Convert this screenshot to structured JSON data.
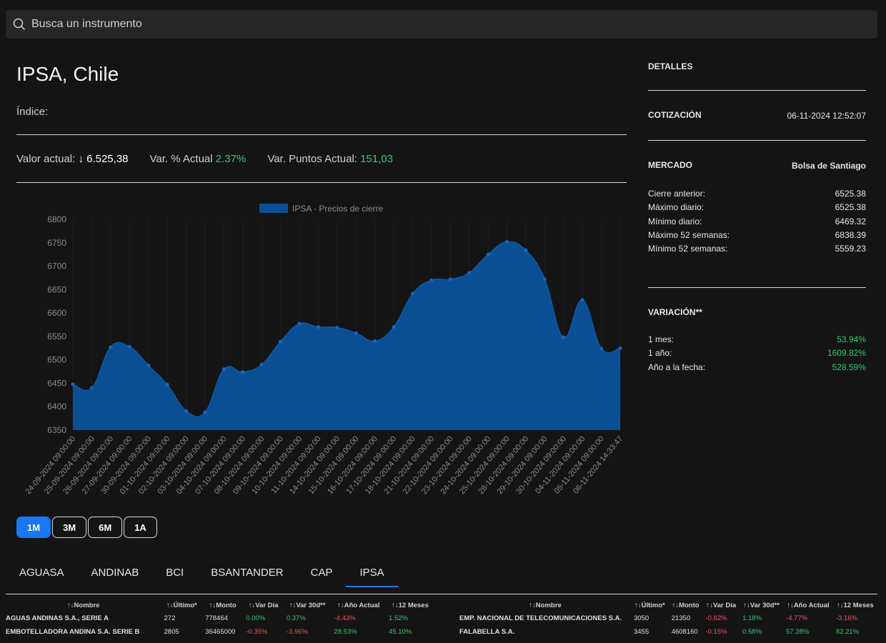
{
  "search": {
    "placeholder": "Busca un instrumento"
  },
  "instrument": {
    "title": "IPSA, Chile",
    "subtitle": "Índice:",
    "valor_label": "Valor actual:",
    "valor_arrow": "↓",
    "valor": "6.525,38",
    "var_pct_label": "Var. % Actual",
    "var_pct": "2.37%",
    "var_pts_label": "Var. Puntos Actual:",
    "var_pts": "151,03"
  },
  "chart_data": {
    "type": "area",
    "legend": "IPSA - Precios de cierre",
    "color": "#0a4f94",
    "ylim": [
      6350,
      6800
    ],
    "yticks": [
      6350,
      6400,
      6450,
      6500,
      6550,
      6600,
      6650,
      6700,
      6750,
      6800
    ],
    "x": [
      "24-09-2024 09:00:00",
      "25-09-2024 09:00:00",
      "26-09-2024 09:00:00",
      "27-09-2024 09:00:00",
      "30-09-2024 09:00:00",
      "01-10-2024 09:00:00",
      "02-10-2024 09:00:00",
      "03-10-2024 09:00:00",
      "04-10-2024 09:00:00",
      "07-10-2024 09:00:00",
      "08-10-2024 09:00:00",
      "09-10-2024 09:00:00",
      "10-10-2024 09:00:00",
      "11-10-2024 09:00:00",
      "14-10-2024 09:00:00",
      "15-10-2024 09:00:00",
      "16-10-2024 09:00:00",
      "17-10-2024 09:00:00",
      "18-10-2024 09:00:00",
      "21-10-2024 09:00:00",
      "22-10-2024 09:00:00",
      "23-10-2024 09:00:00",
      "24-10-2024 09:00:00",
      "25-10-2024 09:00:00",
      "28-10-2024 09:00:00",
      "29-10-2024 09:00:00",
      "30-10-2024 09:00:00",
      "04-11-2024 09:00:00",
      "05-11-2024 09:00:00",
      "06-11-2024 14:33:47"
    ],
    "values": [
      6448,
      6440,
      6527,
      6528,
      6488,
      6447,
      6391,
      6388,
      6480,
      6474,
      6490,
      6539,
      6577,
      6570,
      6569,
      6557,
      6540,
      6570,
      6641,
      6670,
      6672,
      6686,
      6725,
      6752,
      6734,
      6672,
      6548,
      6628,
      6524,
      6525
    ]
  },
  "ranges": [
    "1M",
    "3M",
    "6M",
    "1A"
  ],
  "active_range": "1M",
  "tabs": [
    "AGUASA",
    "ANDINAB",
    "BCI",
    "BSANTANDER",
    "CAP",
    "IPSA"
  ],
  "active_tab": "IPSA",
  "table": {
    "headers": [
      "↑↓Nombre",
      "↑↓Último*",
      "↑↓Monto",
      "↑↓Var Día",
      "↑↓Var 30d**",
      "↑↓Año Actual",
      "↑↓12 Meses"
    ],
    "left_rows": [
      [
        "AGUAS ANDINAS S.A., SERIE A",
        "272",
        "778464",
        "0.00%",
        "0.37%",
        "-4.43%",
        "1.52%"
      ],
      [
        "EMBOTELLADORA ANDINA S.A. SERIE B",
        "2805",
        "36465000",
        "-0.35%",
        "-3.96%",
        "28.53%",
        "45.10%"
      ]
    ],
    "right_rows": [
      [
        "EMP. NACIONAL DE TELECOMUNICACIONES S.A.",
        "3050",
        "21350",
        "-0.62%",
        "1.18%",
        "-4.77%",
        "-3.16%"
      ],
      [
        "FALABELLA S.A.",
        "3455",
        "4608160",
        "-0.15%",
        "0.58%",
        "57.28%",
        "82.21%"
      ]
    ]
  },
  "details": {
    "heading": "DETALLES",
    "cotizacion_label": "COTIZACIÓN",
    "cotizacion": "06-11-2024 12:52:07",
    "mercado_label": "MERCADO",
    "mercado": "Bolsa de Santiago",
    "rows": [
      {
        "label": "Cierre anterior:",
        "value": "6525.38"
      },
      {
        "label": "Máximo diario:",
        "value": "6525.38"
      },
      {
        "label": "Mínimo diario:",
        "value": "6469.32"
      },
      {
        "label": "Máximo 52 semanas:",
        "value": "6838.39"
      },
      {
        "label": "Mínimo 52 semanas:",
        "value": "5559.23"
      }
    ],
    "variacion_label": "VARIACIÓN**",
    "variacion": [
      {
        "label": "1 mes:",
        "value": "53.94%"
      },
      {
        "label": "1 año:",
        "value": "1609.82%"
      },
      {
        "label": "Año a la fecha:",
        "value": "528.59%"
      }
    ]
  }
}
